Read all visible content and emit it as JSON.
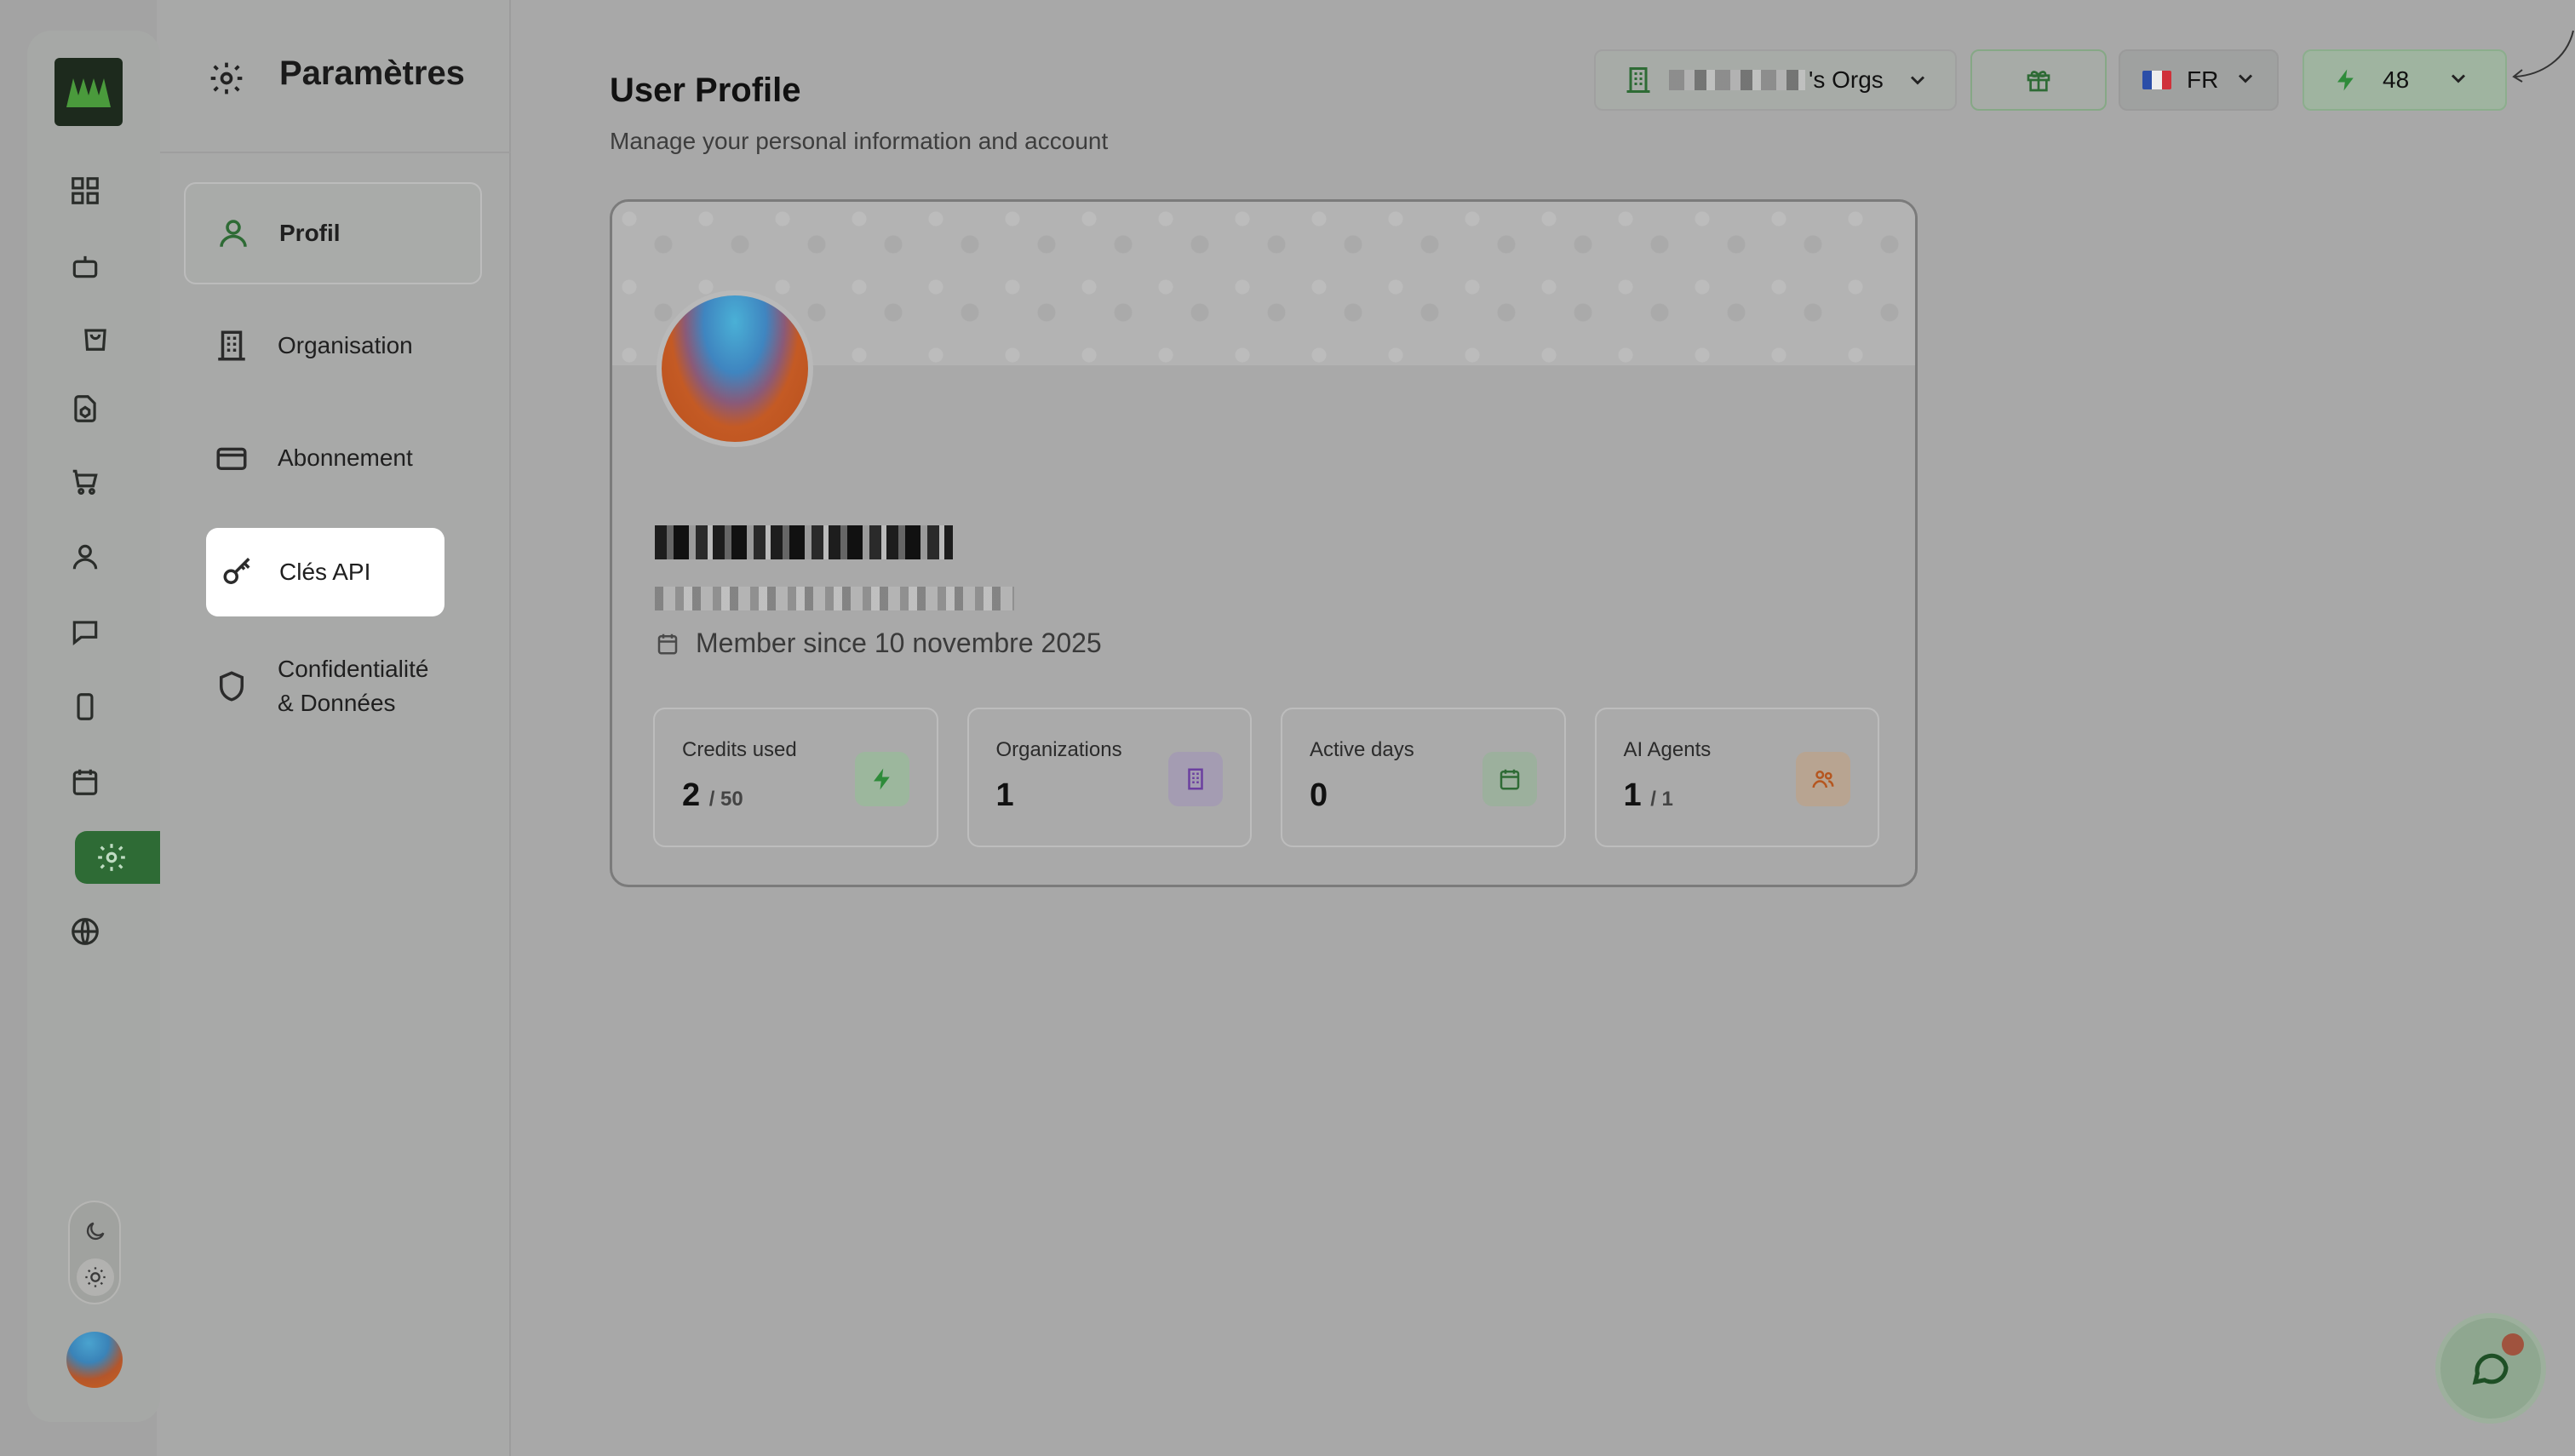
{
  "settings": {
    "title": "Paramètres",
    "nav": [
      {
        "label": "Profil",
        "icon": "user-icon",
        "active": true
      },
      {
        "label": "Organisation",
        "icon": "building-icon"
      },
      {
        "label": "Abonnement",
        "icon": "credit-card-icon"
      },
      {
        "label": "Clés API",
        "icon": "key-icon",
        "highlighted": true
      },
      {
        "label": "Confidentialité\n& Données",
        "icon": "shield-icon"
      }
    ]
  },
  "rail": {
    "icons": [
      "dashboard-icon",
      "bot-icon",
      "shopping-bag-icon",
      "file-cube-icon",
      "cart-icon",
      "user-icon",
      "message-icon",
      "smartphone-icon",
      "calendar-icon",
      "settings-icon",
      "globe-icon"
    ],
    "active": "settings-icon"
  },
  "header": {
    "title": "User Profile",
    "subtitle": "Manage your personal information and account"
  },
  "topbar": {
    "org_suffix": "'s Orgs",
    "lang": "FR",
    "credits": "48"
  },
  "profile": {
    "member_since": "Member since 10 novembre 2025",
    "stats": [
      {
        "label": "Credits used",
        "value": "2",
        "suffix": "/ 50",
        "icon": "bolt-icon",
        "color": "#2e8b3a"
      },
      {
        "label": "Organizations",
        "value": "1",
        "suffix": "",
        "icon": "building-icon",
        "color": "#6b3fa0"
      },
      {
        "label": "Active days",
        "value": "0",
        "suffix": "",
        "icon": "calendar-icon",
        "color": "#2e6b35"
      },
      {
        "label": "AI Agents",
        "value": "1",
        "suffix": "/ 1",
        "icon": "users-icon",
        "color": "#b5561f"
      }
    ]
  },
  "colors": {
    "accent": "#2e6b35",
    "overlay": "#a8a8a8"
  }
}
